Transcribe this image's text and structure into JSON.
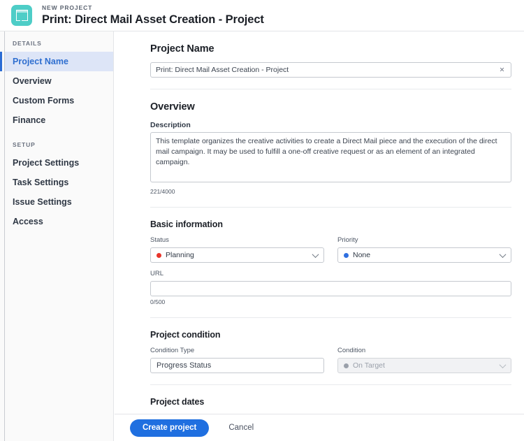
{
  "header": {
    "eyebrow": "NEW PROJECT",
    "title": "Print: Direct Mail Asset Creation - Project",
    "logo_icon": "layout-grid-icon",
    "logo_color": "#4ecdc7"
  },
  "sidebar": {
    "groups": [
      {
        "label": "DETAILS",
        "items": [
          {
            "label": "Project Name",
            "active": true
          },
          {
            "label": "Overview",
            "active": false
          },
          {
            "label": "Custom Forms",
            "active": false
          },
          {
            "label": "Finance",
            "active": false
          }
        ]
      },
      {
        "label": "SETUP",
        "items": [
          {
            "label": "Project Settings",
            "active": false
          },
          {
            "label": "Task Settings",
            "active": false
          },
          {
            "label": "Issue Settings",
            "active": false
          },
          {
            "label": "Access",
            "active": false
          }
        ]
      }
    ],
    "active_accent": "#2b6cd4"
  },
  "main": {
    "project_name": {
      "heading": "Project Name",
      "value": "Print: Direct Mail Asset Creation - Project",
      "placeholder": "Project Name",
      "clear_icon": "×"
    },
    "overview": {
      "heading": "Overview",
      "description_label": "Description",
      "description_value": "This template organizes the creative activities to create a Direct Mail piece and the execution of the direct mail campaign. It may be used to fulfill a one-off creative request or as an element of an integrated campaign.",
      "description_placeholder": "Description",
      "description_count": "221/4000"
    },
    "basic_information": {
      "heading": "Basic information",
      "status_label": "Status",
      "status_value": "Planning",
      "status_dot_color": "#e8352b",
      "priority_label": "Priority",
      "priority_value": "None",
      "priority_dot_color": "#2f6fe0",
      "url_label": "URL",
      "url_value": "",
      "url_placeholder": "",
      "url_count": "0/500"
    },
    "project_condition": {
      "heading": "Project condition",
      "condition_type_label": "Condition Type",
      "condition_type_value": "Progress Status",
      "condition_label": "Condition",
      "condition_value": "On Target",
      "condition_dot_color": "#9aa0aa"
    },
    "project_dates": {
      "heading": "Project dates"
    }
  },
  "footer": {
    "primary_label": "Create project",
    "cancel_label": "Cancel",
    "primary_color": "#1f6fe0"
  }
}
